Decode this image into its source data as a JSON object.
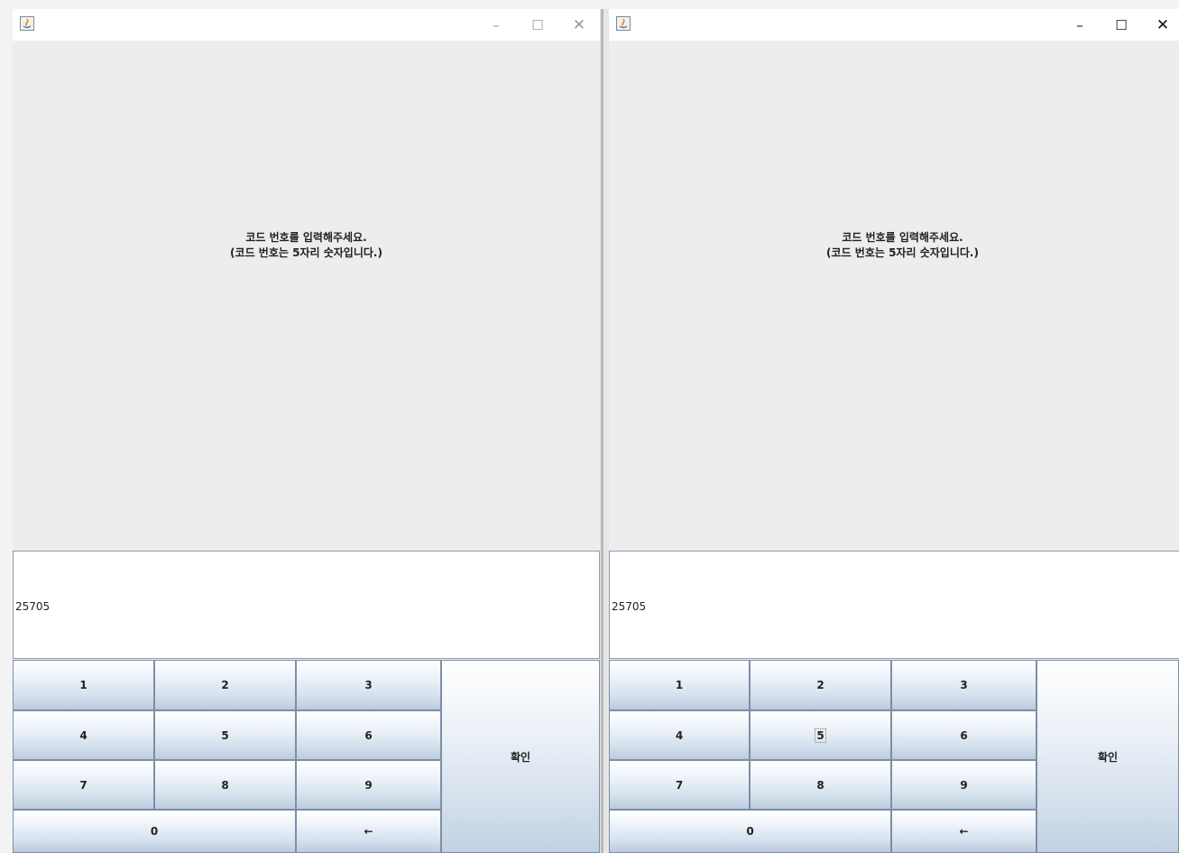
{
  "windows": [
    {
      "id": "left",
      "title_controls": {
        "minimize": "–",
        "maximize": "☐",
        "close": "✕"
      },
      "message": {
        "line1": "코드 번호를 입력해주세요.",
        "line2": "(코드 번호는 5자리 숫자입니다.)"
      },
      "input_value": "25705",
      "keys": {
        "k1": "1",
        "k2": "2",
        "k3": "3",
        "k4": "4",
        "k5": "5",
        "k6": "6",
        "k7": "7",
        "k8": "8",
        "k9": "9",
        "k0": "0",
        "backspace": "←",
        "confirm": "확인"
      }
    },
    {
      "id": "right",
      "title_controls": {
        "minimize": "–",
        "maximize": "☐",
        "close": "✕"
      },
      "message": {
        "line1": "코드 번호를 입력해주세요.",
        "line2": "(코드 번호는 5자리 숫자입니다.)"
      },
      "input_value": "25705",
      "keys": {
        "k1": "1",
        "k2": "2",
        "k3": "3",
        "k4": "4",
        "k5": "5",
        "k6": "6",
        "k7": "7",
        "k8": "8",
        "k9": "9",
        "k0": "0",
        "backspace": "←",
        "confirm": "확인"
      },
      "focused_key": "5"
    }
  ],
  "icons": {
    "app": "java-app-icon",
    "minimize": "minimize-icon",
    "maximize": "maximize-icon",
    "close": "close-icon"
  }
}
